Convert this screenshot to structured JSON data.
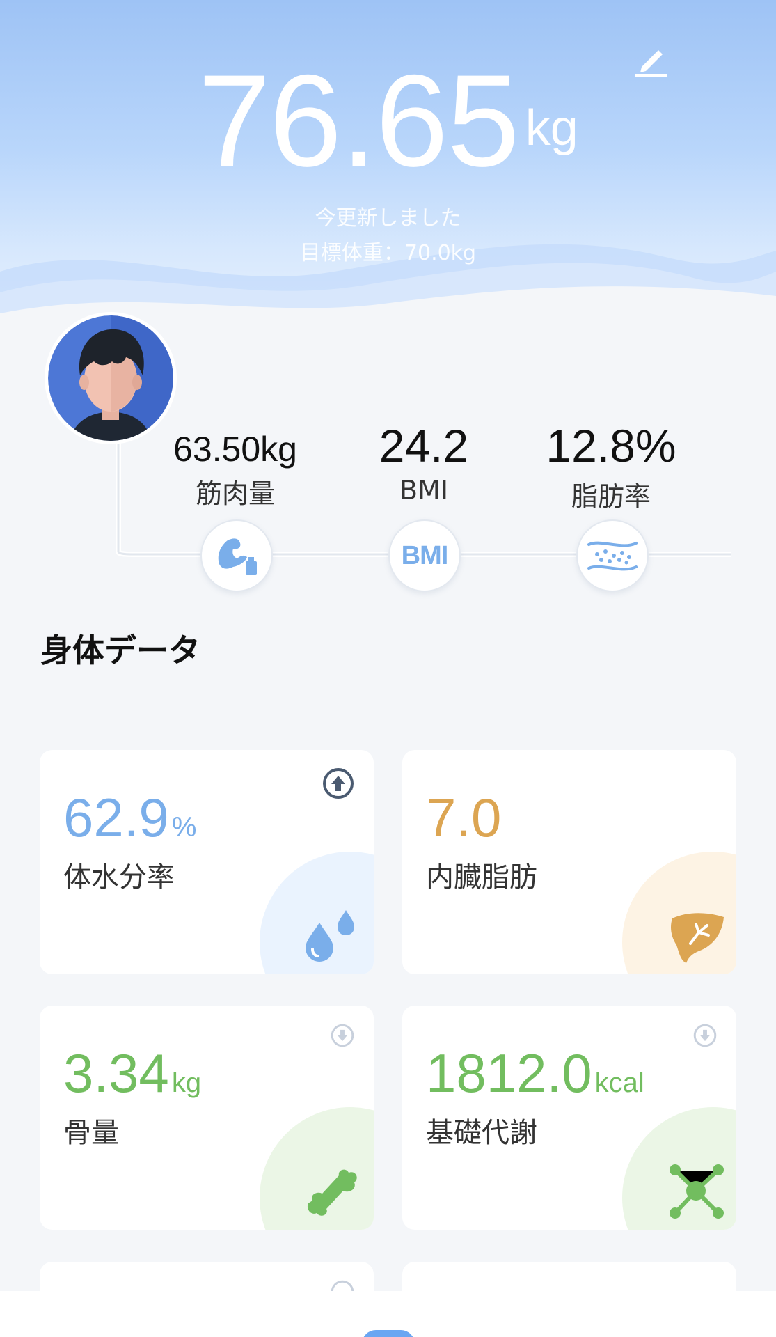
{
  "header": {
    "weight_value": "76.65",
    "weight_unit": "kg",
    "updated_text": "今更新しました",
    "goal_text": "目標体重：70.0kg",
    "edit_icon": "edit-pencil-icon"
  },
  "profile": {
    "avatar_icon": "user-avatar",
    "stats": [
      {
        "value": "63.50kg",
        "label": "筋肉量",
        "icon": "muscle-icon"
      },
      {
        "value": "24.2",
        "label": "BMI",
        "icon": "bmi-icon",
        "icon_text": "BMI"
      },
      {
        "value": "12.8%",
        "label": "脂肪率",
        "icon": "body-fat-icon"
      }
    ]
  },
  "section_title": "身体データ",
  "cards": [
    {
      "value": "62.9",
      "unit": "%",
      "label": "体水分率",
      "color": "#7aaeea",
      "bubble": "#eaf3fe",
      "trend": "up",
      "icon": "water-drops-icon"
    },
    {
      "value": "7.0",
      "unit": "",
      "label": "内臓脂肪",
      "color": "#dca552",
      "bubble": "#fdf3e4",
      "trend": "",
      "icon": "liver-icon"
    },
    {
      "value": "3.34",
      "unit": "kg",
      "label": "骨量",
      "color": "#72bd5f",
      "bubble": "#ebf6e6",
      "trend": "down",
      "icon": "bone-icon"
    },
    {
      "value": "1812.0",
      "unit": "kcal",
      "label": "基礎代謝",
      "color": "#72bd5f",
      "bubble": "#ebf6e6",
      "trend": "down",
      "icon": "molecule-icon"
    }
  ],
  "colors": {
    "accent_blue": "#7aaeea",
    "accent_orange": "#dca552",
    "accent_green": "#72bd5f",
    "background": "#f4f6f9"
  }
}
